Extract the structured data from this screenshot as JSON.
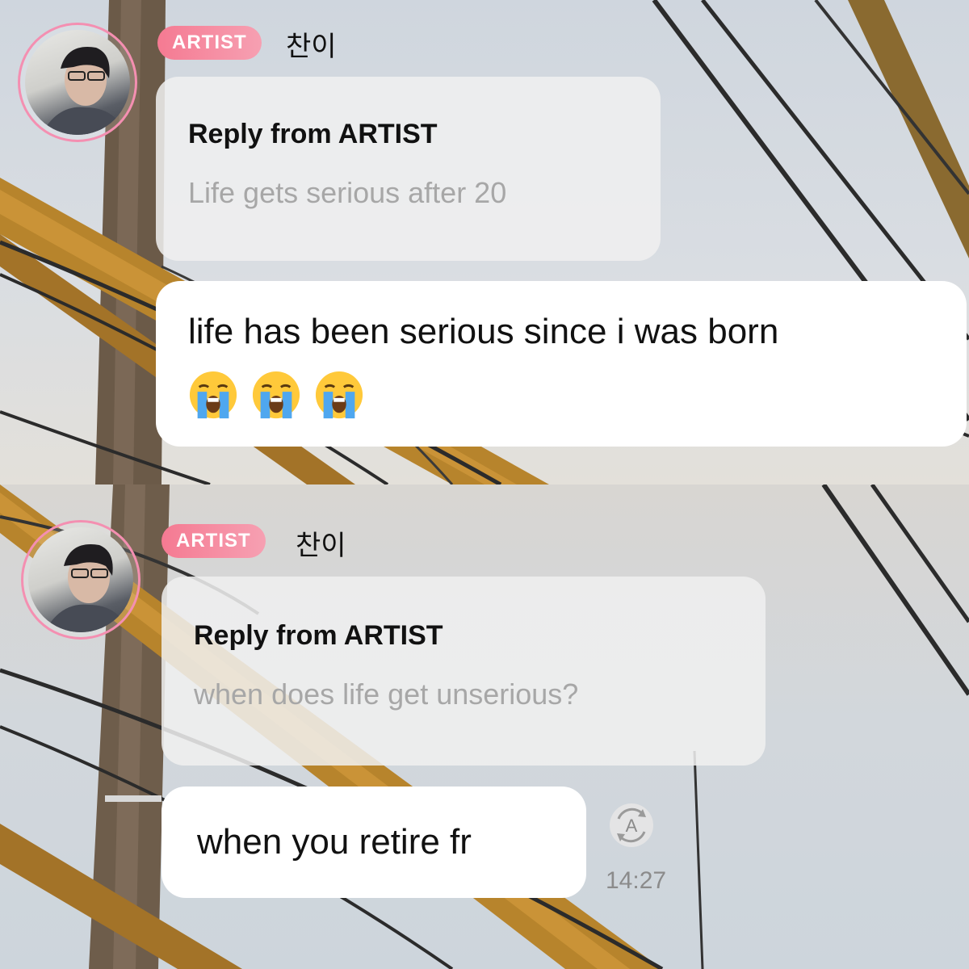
{
  "panels": [
    {
      "artist_badge": "ARTIST",
      "artist_name": "찬이",
      "reply_title": "Reply from ARTIST",
      "reply_quote": "Life gets serious after 20",
      "message": "life has been serious since i was born",
      "emojis": [
        "crying-face",
        "crying-face",
        "crying-face"
      ]
    },
    {
      "artist_badge": "ARTIST",
      "artist_name": "찬이",
      "reply_title": "Reply from ARTIST",
      "reply_quote": "when does life get unserious?",
      "message": "when you retire fr",
      "timestamp": "14:27",
      "translate_icon_label": "A"
    }
  ],
  "colors": {
    "badge_pink": "#f57a92",
    "avatar_ring": "#f48fb1",
    "quote_gray": "#a7a7a7",
    "timestamp_gray": "#8b8b8b"
  },
  "icons": [
    "crying-face-icon",
    "auto-translate-icon"
  ]
}
